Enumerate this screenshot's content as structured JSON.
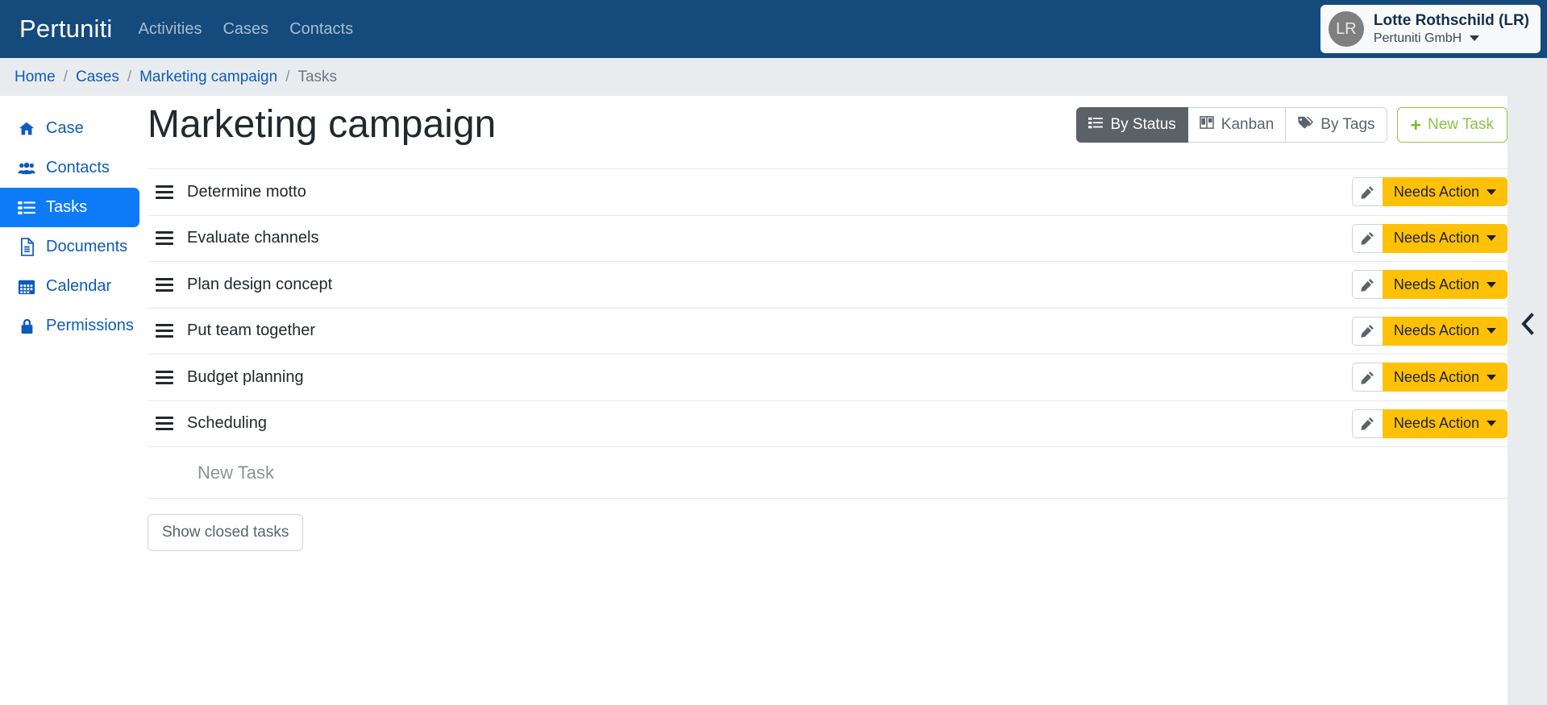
{
  "navbar": {
    "brand": "Pertuniti",
    "links": [
      {
        "label": "Activities"
      },
      {
        "label": "Cases"
      },
      {
        "label": "Contacts"
      }
    ],
    "user": {
      "initials": "LR",
      "name": "Lotte Rothschild (LR)",
      "org": "Pertuniti GmbH"
    }
  },
  "breadcrumb": {
    "separator": "/",
    "items": [
      {
        "label": "Home",
        "current": false
      },
      {
        "label": "Cases",
        "current": false
      },
      {
        "label": "Marketing campaign",
        "current": false
      },
      {
        "label": "Tasks",
        "current": true
      }
    ]
  },
  "sidebar": {
    "items": [
      {
        "label": "Case",
        "icon": "home-icon",
        "active": false
      },
      {
        "label": "Contacts",
        "icon": "users-icon",
        "active": false
      },
      {
        "label": "Tasks",
        "icon": "list-icon",
        "active": true
      },
      {
        "label": "Documents",
        "icon": "document-icon",
        "active": false
      },
      {
        "label": "Calendar",
        "icon": "calendar-icon",
        "active": false
      },
      {
        "label": "Permissions",
        "icon": "lock-icon",
        "active": false
      }
    ]
  },
  "main": {
    "title": "Marketing campaign",
    "views": [
      {
        "label": "By Status",
        "icon": "list-icon",
        "active": true
      },
      {
        "label": "Kanban",
        "icon": "columns-icon",
        "active": false
      },
      {
        "label": "By Tags",
        "icon": "tag-icon",
        "active": false
      }
    ],
    "new_task_button": {
      "label": "New Task",
      "icon": "plus-icon"
    },
    "tasks": [
      {
        "name": "Determine motto",
        "status": "Needs Action"
      },
      {
        "name": "Evaluate channels",
        "status": "Needs Action"
      },
      {
        "name": "Plan design concept",
        "status": "Needs Action"
      },
      {
        "name": "Put team together",
        "status": "Needs Action"
      },
      {
        "name": "Budget planning",
        "status": "Needs Action"
      },
      {
        "name": "Scheduling",
        "status": "Needs Action"
      }
    ],
    "new_task_placeholder": "New Task",
    "show_closed_tasks_label": "Show closed tasks",
    "collapse_icon": "chevron-left-icon"
  },
  "colors": {
    "navbar": "#144a7c",
    "page_background": "#e9ecef",
    "link": "#0d5bbd",
    "active_sidebar": "#0d7bf8",
    "status_badge": "#ffc107",
    "new_task_accent": "#8bc34a",
    "segment_active": "#5a6167"
  }
}
